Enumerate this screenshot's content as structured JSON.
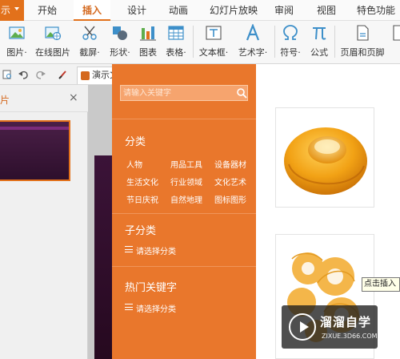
{
  "menubar": {
    "app_menu": "示",
    "tabs": [
      "开始",
      "插入",
      "设计",
      "动画",
      "幻灯片放映",
      "审阅",
      "视图",
      "特色功能"
    ],
    "active_tab": "插入"
  },
  "ribbon": {
    "buttons": [
      {
        "label": "图片·",
        "icon": "picture-icon"
      },
      {
        "label": "在线图片",
        "icon": "online-picture-icon"
      },
      {
        "label": "截屏·",
        "icon": "screenshot-icon"
      },
      {
        "label": "形状·",
        "icon": "shapes-icon"
      },
      {
        "label": "图表",
        "icon": "chart-icon"
      },
      {
        "label": "表格·",
        "icon": "table-icon"
      },
      {
        "label": "文本框·",
        "icon": "textbox-icon"
      },
      {
        "label": "艺术字·",
        "icon": "wordart-icon"
      },
      {
        "label": "符号·",
        "icon": "symbol-icon"
      },
      {
        "label": "公式",
        "icon": "formula-icon"
      },
      {
        "label": "页眉和页脚",
        "icon": "header-footer-icon"
      }
    ]
  },
  "quickbar": {
    "doc_tab": "演示文"
  },
  "leftpane": {
    "title": "片",
    "close": "×"
  },
  "online_panel": {
    "search_placeholder": "请输入关键字",
    "section_category": "分类",
    "categories": [
      "人物",
      "用品工具",
      "设备器材",
      "生活文化",
      "行业领域",
      "文化艺术",
      "节日庆祝",
      "自然地理",
      "图标图形"
    ],
    "section_subcategory": "子分类",
    "subcategory_select": "请选择分类",
    "section_hot": "热门关键字",
    "hot_select": "请选择分类"
  },
  "results": {
    "tooltip": "点击插入"
  },
  "watermark": {
    "name": "溜溜自学",
    "url": "ZIXUE.3D66.COM"
  },
  "colors": {
    "accent": "#e2711b",
    "panel": "#e9772c",
    "slide": "#3b1338"
  }
}
